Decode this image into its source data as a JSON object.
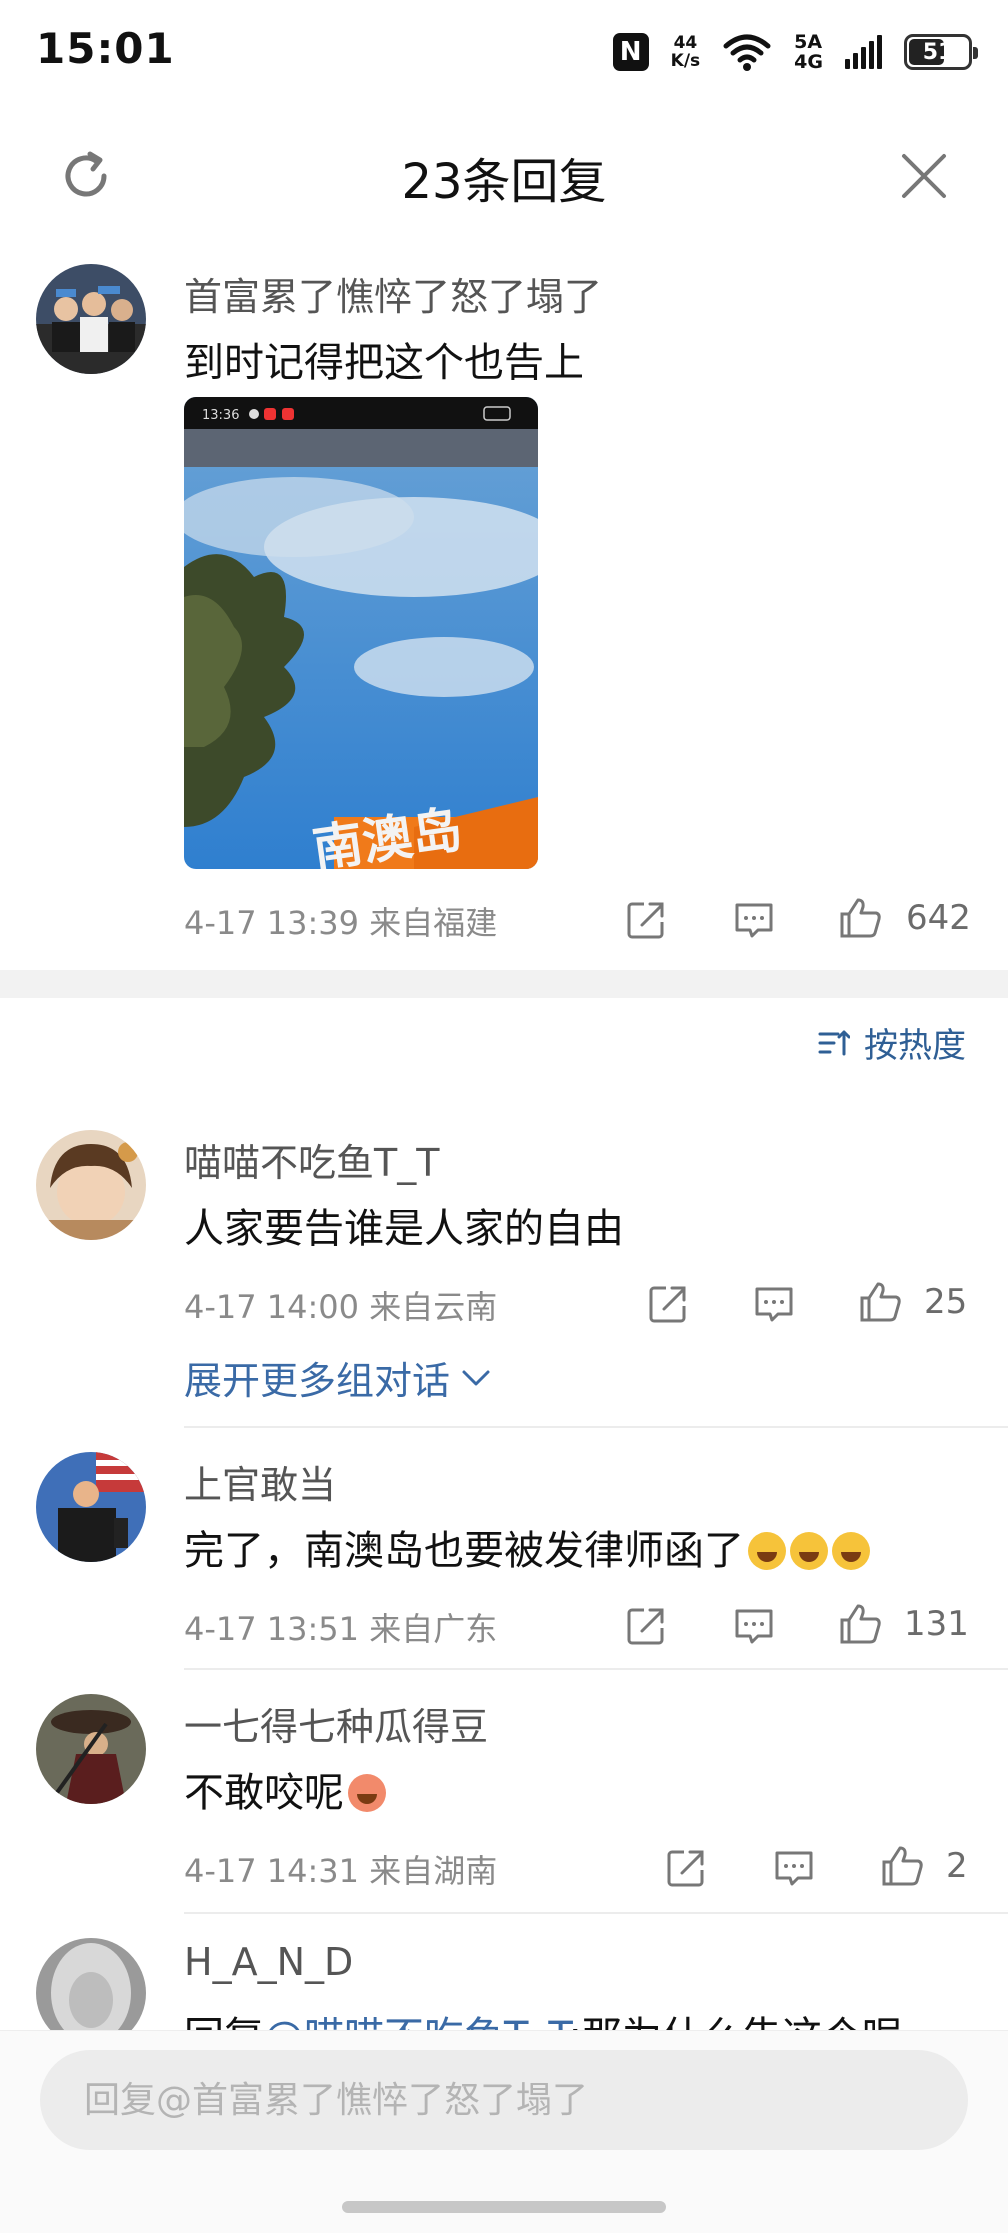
{
  "status_bar": {
    "time": "15:01",
    "nfc": "N",
    "speed_value": "44",
    "speed_unit": "K/s",
    "network_top": "5A",
    "network_bottom": "4G",
    "battery_level": "51"
  },
  "header": {
    "title": "23条回复",
    "icons": [
      "refresh-icon",
      "close-icon"
    ]
  },
  "main_comment": {
    "username": "首富累了憔悴了怒了塌了",
    "text": "到时记得把这个也告上",
    "media": {
      "phone_time": "13:36",
      "sign_text": "南澳岛"
    },
    "meta": "4-17 13:39 来自福建",
    "like_count": "642"
  },
  "sort": {
    "label": "按热度",
    "icon": "sort-icon"
  },
  "replies": [
    {
      "username": "喵喵不吃鱼T_T",
      "text": "人家要告谁是人家的自由",
      "meta": "4-17 14:00 来自云南",
      "like_count": "25",
      "expand_label": "展开更多组对话"
    },
    {
      "username": "上官敢当",
      "text": "完了，南澳岛也要被发律师函了",
      "meta": "4-17 13:51 来自广东",
      "like_count": "131"
    },
    {
      "username": "一七得七种瓜得豆",
      "text": "不敢咬呢",
      "meta": "4-17 14:31 来自湖南",
      "like_count": "2"
    },
    {
      "username": "H_A_N_D",
      "text_prefix": "回复",
      "mention": "@喵喵不吃鱼T_T",
      "text_rest": ":那为什么告这个呢"
    }
  ],
  "reply_box": {
    "placeholder": "回复@首富累了憔悴了怒了塌了"
  },
  "colors": {
    "link_blue": "#3a6aa6",
    "meta_gray": "#8a8a8a",
    "separator": "#f2f2f2"
  }
}
